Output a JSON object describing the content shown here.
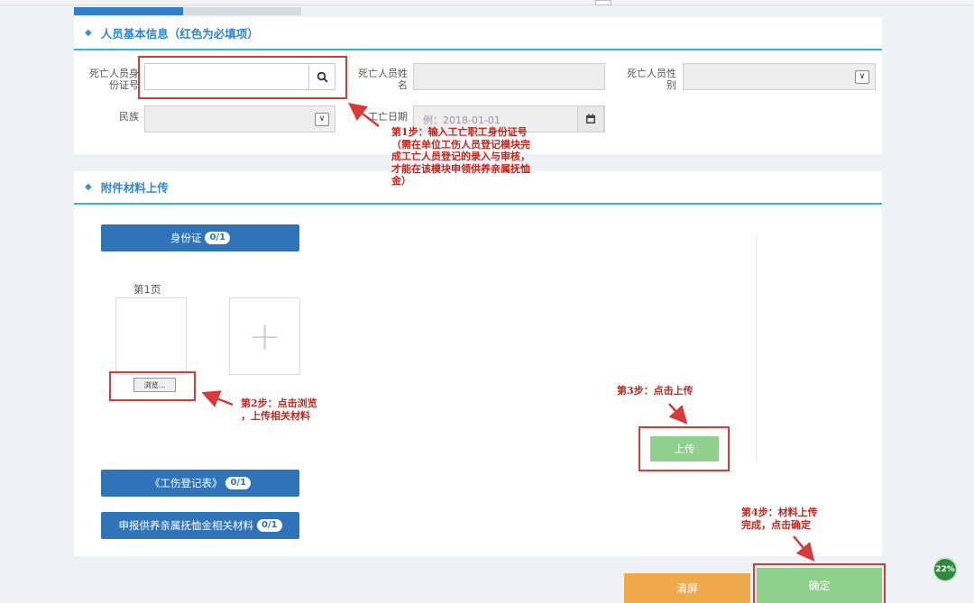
{
  "progress": {
    "fill_fraction": 0.48
  },
  "section_basic": {
    "title": "人员基本信息（红色为必填项）",
    "id_label_1": "死亡人员身",
    "id_label_2": "份证号",
    "id_value": "",
    "name_label_1": "死亡人员姓",
    "name_label_2": "名",
    "name_value": "",
    "gender_label_1": "死亡人员性",
    "gender_label_2": "别",
    "gender_value": "",
    "ethnicity_label": "民族",
    "ethnicity_value": "",
    "death_date_label": "工亡日期",
    "death_date_placeholder": "例：2018-01-01"
  },
  "section_upload": {
    "title": "附件材料上传",
    "id_card_button": "身份证",
    "id_card_badge": "0/1",
    "page_label": "第1页",
    "browse_label": "浏览...",
    "add_symbol": "+",
    "upload_button": "上传",
    "registration_button": "《工伤登记表》",
    "registration_badge": "0/1",
    "materials_button": "申报供养亲属抚恤金相关材料",
    "materials_badge": "0/1"
  },
  "annotations": {
    "step1": [
      "第1步：输入工亡职工身份证号",
      "（需在单位工伤人员登记模块完",
      "成工亡人员登记的录入与审核，",
      "才能在该模块申领供养亲属抚恤",
      "金）"
    ],
    "step2": [
      "第2步：点击浏览",
      "，上传相关材料"
    ],
    "step3": "第3步：点击上传",
    "step4": [
      "第4步：材料上传",
      "完成，点击确定"
    ]
  },
  "footer": {
    "clear_button": "清屏",
    "confirm_button": "确定"
  },
  "float_badge": "22%",
  "colors": {
    "accent_blue": "#2f73b8",
    "annotation_red": "#d63a3a",
    "upload_green": "#8fd08d",
    "clear_orange": "#f0a94a",
    "header_line": "#2bb6dc"
  }
}
